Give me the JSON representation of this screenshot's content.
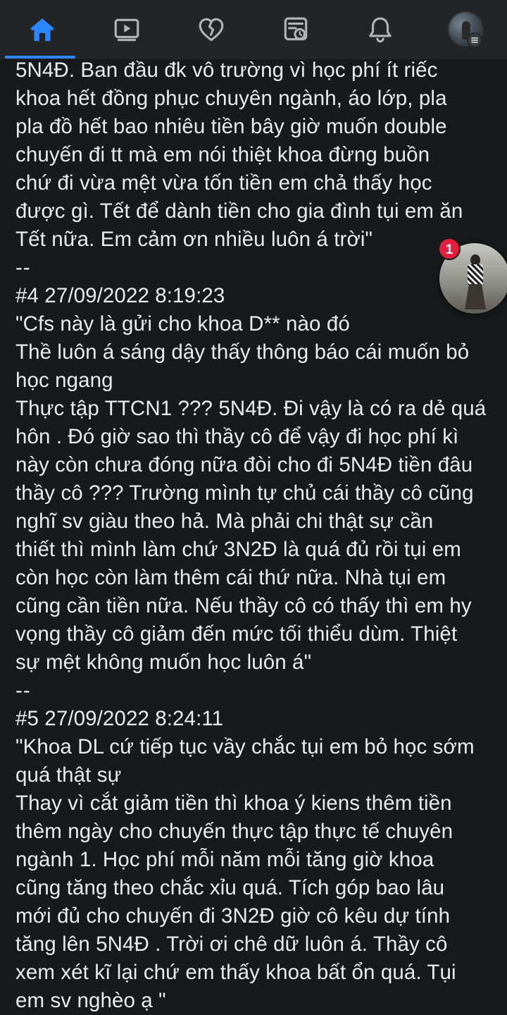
{
  "nav": {
    "items": [
      {
        "name": "home",
        "icon": "home-icon",
        "active": true
      },
      {
        "name": "watch",
        "icon": "video-play-icon",
        "active": false
      },
      {
        "name": "dating",
        "icon": "heart-icon",
        "active": false
      },
      {
        "name": "feeds",
        "icon": "newsfeed-clock-icon",
        "active": false
      },
      {
        "name": "notifications",
        "icon": "bell-icon",
        "active": false
      },
      {
        "name": "menu",
        "icon": "profile-avatar-menu-icon",
        "active": false
      }
    ],
    "accent_color": "#2d88ff",
    "icon_color": "#b0b3b8"
  },
  "chathead": {
    "badge_count": "1",
    "badge_color": "#e41e3f"
  },
  "post": {
    "lines": [
      "5N4Đ. Ban đầu đk vô trường vì học phí ít riếc",
      "khoa hết đồng phục chuyên ngành, áo lớp, pla",
      "pla đồ hết bao nhiêu tiền bây giờ muốn double",
      "chuyến đi tt mà em nói thiệt khoa đừng buồn",
      "chứ đi vừa mệt vừa tốn tiền em chả thấy học",
      "được gì. Tết để dành tiền cho gia đình tụi em ăn",
      "Tết nữa. Em cảm ơn nhiều luôn á trời\"",
      "--",
      "#4 27/09/2022 8:19:23",
      "\"Cfs này là gửi cho khoa D** nào đó",
      "Thề luôn á sáng dậy thấy thông báo cái muốn bỏ",
      "học ngang",
      "Thực tập TTCN1 ??? 5N4Đ. Đi vậy là có ra dẻ quá",
      "hôn . Đó giờ sao thì thầy cô để vậy đi học phí kì",
      "này còn chưa đóng nữa đòi cho đi 5N4Đ tiền đâu",
      "thầy cô ??? Trường mình tự chủ cái thầy cô cũng",
      "nghĩ sv giàu theo hả. Mà phải chi thật sự cần",
      "thiết thì mình làm chứ 3N2Đ là quá đủ rồi tụi em",
      "còn học còn làm thêm cái thứ nữa. Nhà tụi em",
      "cũng cần tiền nữa. Nếu thầy cô có thấy thì em hy",
      "vọng thầy cô giảm đến mức tối thiểu dùm. Thiệt",
      "sự mệt không muốn học luôn á\"",
      "--",
      "#5 27/09/2022 8:24:11",
      "\"Khoa DL cứ tiếp tục vầy chắc tụi em bỏ học sớm",
      "quá thật sự",
      "Thay vì cắt giảm tiền thì khoa ý kiens thêm tiền",
      "thêm ngày cho chuyến thực tập thực tế chuyên",
      "ngành 1. Học phí mỗi năm mỗi tăng giờ khoa",
      "cũng tăng theo chắc xỉu quá. Tích góp bao lâu",
      "mới đủ cho chuyến đi 3N2Đ giờ cô kêu dự tính",
      "tăng lên 5N4Đ . Trời ơi chê dữ luôn á. Thầy cô",
      "xem xét kĩ lại chứ em thấy khoa bất ổn quá. Tụi",
      "em sv nghèo ạ \""
    ]
  }
}
